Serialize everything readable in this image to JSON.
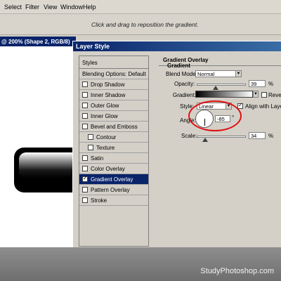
{
  "menubar": {
    "items": [
      "Select",
      "Filter",
      "View",
      "Window",
      "Help"
    ]
  },
  "options": {
    "hint": "Click and drag to reposition the gradient."
  },
  "document": {
    "title": "@ 200% (Shape 2, RGB/8)"
  },
  "dialog": {
    "title": "Layer Style",
    "styles_header": "Styles",
    "blending_label": "Blending Options: Default",
    "items": [
      {
        "label": "Drop Shadow",
        "checked": false
      },
      {
        "label": "Inner Shadow",
        "checked": false
      },
      {
        "label": "Outer Glow",
        "checked": false
      },
      {
        "label": "Inner Glow",
        "checked": false
      },
      {
        "label": "Bevel and Emboss",
        "checked": false
      },
      {
        "label": "Contour",
        "checked": false
      },
      {
        "label": "Texture",
        "checked": false
      },
      {
        "label": "Satin",
        "checked": false
      },
      {
        "label": "Color Overlay",
        "checked": false
      },
      {
        "label": "Gradient Overlay",
        "checked": true
      },
      {
        "label": "Pattern Overlay",
        "checked": false
      },
      {
        "label": "Stroke",
        "checked": false
      }
    ],
    "panel": {
      "section_title": "Gradient Overlay",
      "group_title": "Gradient",
      "blend_mode_label": "Blend Mode:",
      "blend_mode_value": "Normal",
      "opacity_label": "Opacity:",
      "opacity_value": "39",
      "opacity_unit": "%",
      "gradient_label": "Gradient:",
      "reverse_label": "Revers",
      "style_label": "Style:",
      "style_value": "Linear",
      "align_label": "Align with Layer",
      "angle_label": "Angle:",
      "angle_value": "-85",
      "angle_unit": "°",
      "scale_label": "Scale:",
      "scale_value": "34",
      "scale_unit": "%"
    }
  },
  "watermark": "StudyPhotoshop.com",
  "colors": {
    "title_bar": "#0a246a",
    "dialog_bg": "#d4d0c8",
    "annotation": "#e01010"
  }
}
